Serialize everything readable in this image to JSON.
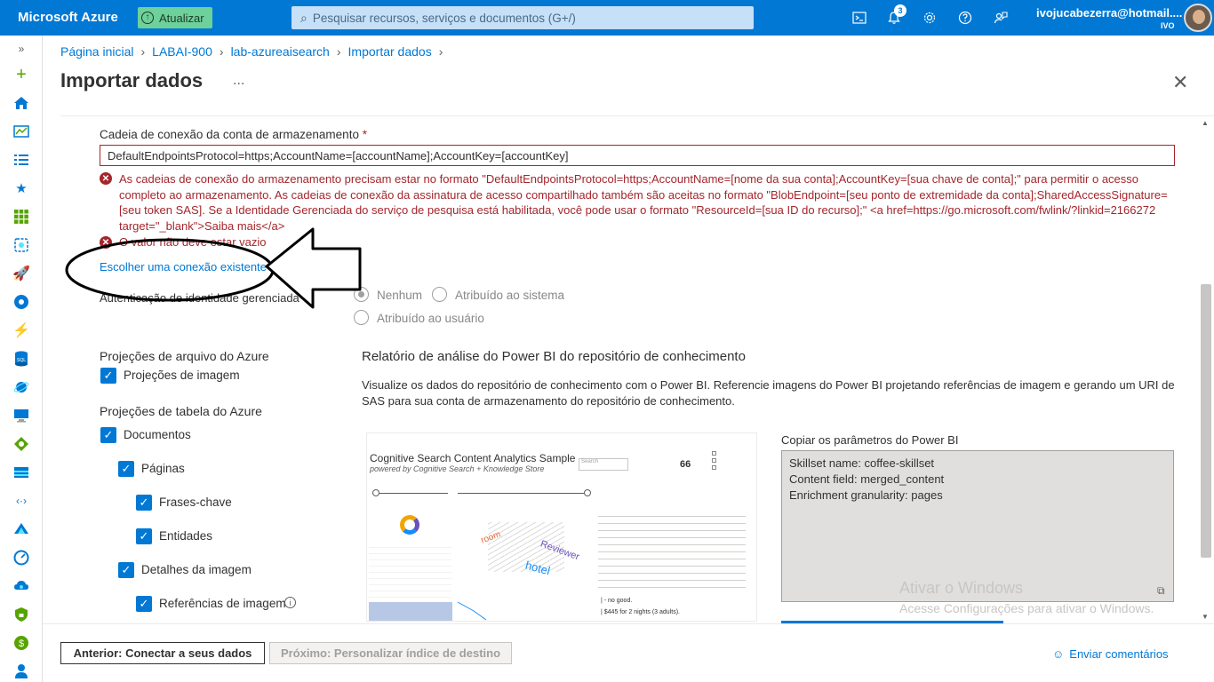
{
  "topbar": {
    "brand": "Microsoft Azure",
    "upgrade_label": "Atualizar",
    "search_placeholder": "Pesquisar recursos, serviços e documentos (G+/)",
    "notification_count": "3",
    "user_email": "ivojucabezerra@hotmail....",
    "user_tenant": "IVO",
    "icons": [
      "cloud-shell-icon",
      "bell-icon",
      "gear-icon",
      "help-icon",
      "feedback-icon"
    ]
  },
  "breadcrumb": [
    "Página inicial",
    "LABAI-900",
    "lab-azureaisearch",
    "Importar dados"
  ],
  "page": {
    "title": "Importar dados",
    "more": "...",
    "close": "✕"
  },
  "connection": {
    "label": "Cadeia de conexão da conta de armazenamento",
    "required": "*",
    "value": "DefaultEndpointsProtocol=https;AccountName=[accountName];AccountKey=[accountKey]",
    "error_1": "As cadeias de conexão do armazenamento precisam estar no formato \"DefaultEndpointsProtocol=https;AccountName=[nome da sua conta];AccountKey=[sua chave de conta];\" para permitir o acesso completo ao armazenamento. As cadeias de conexão da assinatura de acesso compartilhado também são aceitas no formato \"BlobEndpoint=[seu ponto de extremidade da conta];SharedAccessSignature=[seu token SAS]. Se a Identidade Gerenciada do serviço de pesquisa está habilitada, você pode usar o formato \"ResourceId=[sua ID do recurso];\" <a href=https://go.microsoft.com/fwlink/?linkid=2166272 target=\"_blank\">Saiba mais</a>",
    "error_2": "O valor não deve estar vazio",
    "choose_existing": "Escolher uma conexão existente"
  },
  "identity": {
    "label": "Autenticação de identidade gerenciada",
    "options": [
      "Nenhum",
      "Atribuído ao sistema",
      "Atribuído ao usuário"
    ],
    "selected": "Nenhum"
  },
  "projections": {
    "file_title": "Projeções de arquivo do Azure",
    "file_items": [
      {
        "label": "Projeções de imagem",
        "checked": true
      }
    ],
    "table_title": "Projeções de tabela do Azure",
    "table_items": [
      {
        "label": "Documentos",
        "checked": true
      },
      {
        "label": "Páginas",
        "checked": true
      },
      {
        "label": "Frases-chave",
        "checked": true
      },
      {
        "label": "Entidades",
        "checked": true
      },
      {
        "label": "Detalhes da imagem",
        "checked": true
      },
      {
        "label": "Referências de imagem",
        "checked": true
      }
    ]
  },
  "powerbi": {
    "title": "Relatório de análise do Power BI do repositório de conhecimento",
    "description": "Visualize os dados do repositório de conhecimento com o Power BI. Referencie imagens do Power BI projetando referências de imagem e gerando um URI de SAS para sua conta de armazenamento do repositório de conhecimento.",
    "preview_title": "Cognitive Search Content Analytics Sample",
    "preview_subtitle": "powered by Cognitive Search + Knowledge Store",
    "preview_count": "66",
    "preview_search": "Search",
    "preview_words": [
      "Reviewer",
      "hotel",
      "room"
    ],
    "preview_doc_lines": [
      "| - no good.",
      "| $445 for 2 nights (3 adults)."
    ],
    "copy_label": "Copiar os parâmetros do Power BI",
    "params": [
      "Skillset name: coffee-skillset",
      "Content field: merged_content",
      "Enrichment granularity: pages"
    ]
  },
  "watermark": {
    "line1": "Ativar o Windows",
    "line2": "Acesse Configurações para ativar o Windows."
  },
  "footer": {
    "prev": "Anterior: Conectar a seus dados",
    "next": "Próximo: Personalizar índice de destino",
    "feedback": "Enviar comentários"
  }
}
